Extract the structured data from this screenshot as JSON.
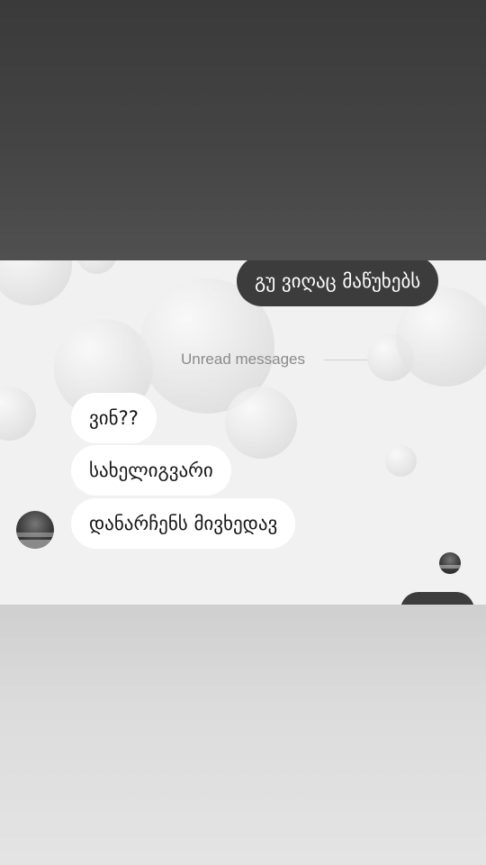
{
  "chat": {
    "outgoing": [
      {
        "text": "გუ ვიღაც მაწუხებს"
      }
    ],
    "divider": {
      "label": "Unread messages"
    },
    "incoming": [
      {
        "text": "ვინ??"
      },
      {
        "text": "სახელიგვარი"
      },
      {
        "text": "დანარჩენს მივხედავ"
      }
    ]
  },
  "colors": {
    "outgoing_bubble": "#3c3c3c",
    "incoming_bubble": "#ffffff",
    "chat_background": "#f1f1f1"
  }
}
